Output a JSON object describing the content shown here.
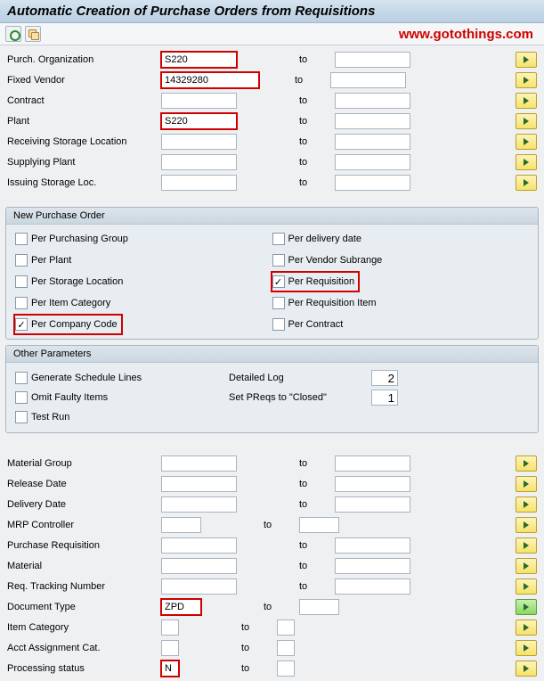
{
  "title": "Automatic Creation of Purchase Orders from Requisitions",
  "watermark": "www.gotothings.com",
  "top_fields": [
    {
      "label": "Purch. Organization",
      "from": "S220",
      "to_label": "to",
      "to": "",
      "hl": true,
      "narrow_from": false
    },
    {
      "label": "Fixed Vendor",
      "from": "14329280",
      "to_label": "to",
      "to": "",
      "hl": true,
      "wide": true
    },
    {
      "label": "Contract",
      "from": "",
      "to_label": "to",
      "to": ""
    },
    {
      "label": "Plant",
      "from": "S220",
      "to_label": "to",
      "to": "",
      "hl": true
    },
    {
      "label": "Receiving Storage Location",
      "from": "",
      "to_label": "to",
      "to": ""
    },
    {
      "label": "Supplying Plant",
      "from": "",
      "to_label": "to",
      "to": ""
    },
    {
      "label": "Issuing Storage Loc.",
      "from": "",
      "to_label": "to",
      "to": ""
    }
  ],
  "group_new_po": {
    "title": "New Purchase Order",
    "left": [
      {
        "label": "Per Purchasing Group",
        "checked": false,
        "hl": false
      },
      {
        "label": "Per Plant",
        "checked": false,
        "hl": false
      },
      {
        "label": "Per Storage Location",
        "checked": false,
        "hl": false
      },
      {
        "label": "Per Item Category",
        "checked": false,
        "hl": false
      },
      {
        "label": "Per Company Code",
        "checked": true,
        "hl": true
      }
    ],
    "right": [
      {
        "label": "Per delivery date",
        "checked": false,
        "hl": false
      },
      {
        "label": "Per Vendor Subrange",
        "checked": false,
        "hl": false
      },
      {
        "label": "Per Requisition",
        "checked": true,
        "hl": true
      },
      {
        "label": "Per Requisition Item",
        "checked": false,
        "hl": false
      },
      {
        "label": "Per Contract",
        "checked": false,
        "hl": false
      }
    ]
  },
  "group_other": {
    "title": "Other Parameters",
    "left": [
      {
        "label": "Generate Schedule Lines",
        "checked": false
      },
      {
        "label": "Omit Faulty Items",
        "checked": false
      },
      {
        "label": "Test Run",
        "checked": false
      }
    ],
    "right": [
      {
        "label": "Detailed Log",
        "value": "2"
      },
      {
        "label": "Set PReqs to \"Closed\"",
        "value": "1"
      }
    ]
  },
  "bottom_fields": [
    {
      "label": "Material Group",
      "from": "",
      "to_label": "to",
      "to": ""
    },
    {
      "label": "Release Date",
      "from": "",
      "to_label": "to",
      "to": ""
    },
    {
      "label": "Delivery Date",
      "from": "",
      "to_label": "to",
      "to": ""
    },
    {
      "label": "MRP Controller",
      "from": "",
      "to_label": "to",
      "to": "",
      "narrow": true
    },
    {
      "label": "Purchase Requisition",
      "from": "",
      "to_label": "to",
      "to": ""
    },
    {
      "label": "Material",
      "from": "",
      "to_label": "to",
      "to": ""
    },
    {
      "label": "Req. Tracking Number",
      "from": "",
      "to_label": "to",
      "to": ""
    },
    {
      "label": "Document Type",
      "from": "ZPD",
      "to_label": "to",
      "to": "",
      "hl": true,
      "narrow": true,
      "green": true
    },
    {
      "label": "Item Category",
      "from": "",
      "to_label": "to",
      "to": "",
      "tiny": true
    },
    {
      "label": "Acct Assignment Cat.",
      "from": "",
      "to_label": "to",
      "to": "",
      "tiny": true
    },
    {
      "label": "Processing status",
      "from": "N",
      "to_label": "to",
      "to": "",
      "hl": true,
      "tiny": true
    }
  ]
}
